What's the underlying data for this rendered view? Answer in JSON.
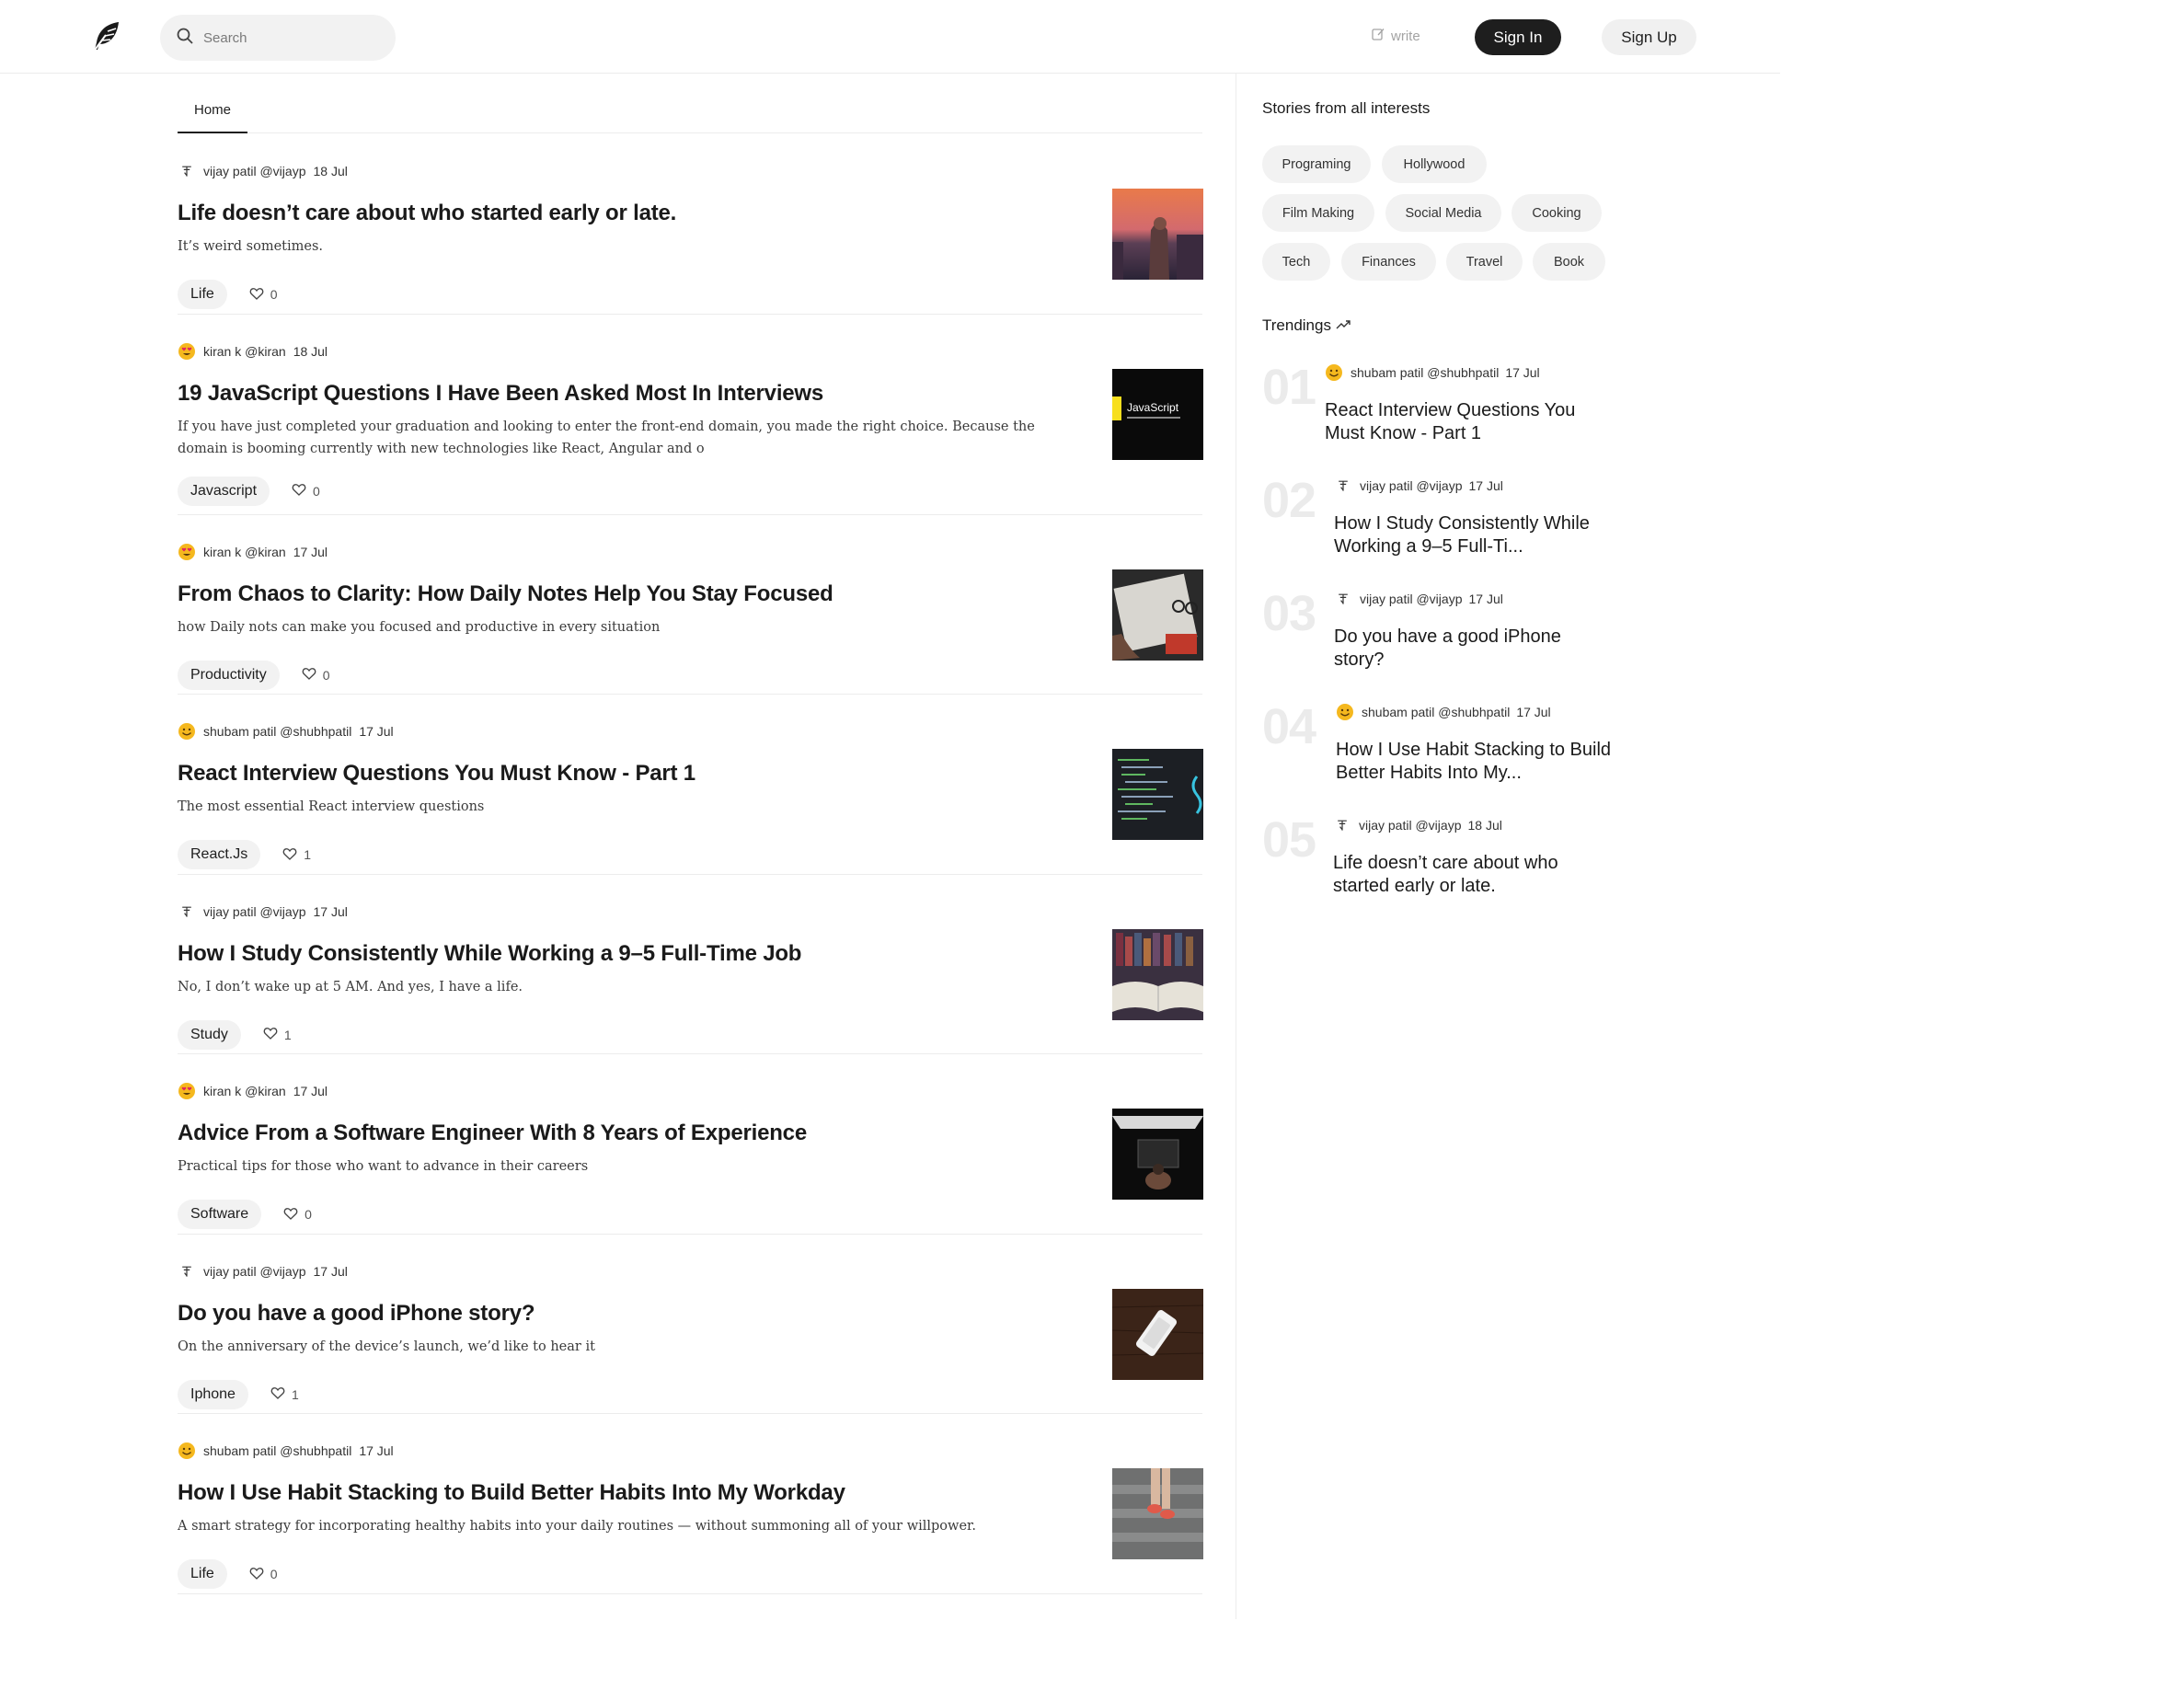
{
  "header": {
    "search_placeholder": "Search",
    "write_label": "write",
    "signin_label": "Sign In",
    "signup_label": "Sign Up"
  },
  "tabs": {
    "home": "Home"
  },
  "posts": [
    {
      "avatar": "pen-avatar",
      "author": "vijay patil @vijayp",
      "date": "18 Jul",
      "title": "Life doesn’t care about who started early or late.",
      "description": "It’s weird sometimes.",
      "tag": "Life",
      "likes": "0",
      "thumb": "sunset-city"
    },
    {
      "avatar": "heart-eyes-emoji",
      "author": "kiran k @kiran",
      "date": "18 Jul",
      "title": "19 JavaScript Questions I Have Been Asked Most In Interviews",
      "description": "If you have just completed your graduation and looking to enter the front-end domain, you made the right choice. Because the domain is booming currently with new technologies like React, Angular and o",
      "tag": "Javascript",
      "likes": "0",
      "thumb": "javascript",
      "thumb_text": "JavaScript"
    },
    {
      "avatar": "heart-eyes-emoji",
      "author": "kiran k @kiran",
      "date": "17 Jul",
      "title": "From Chaos to Clarity: How Daily Notes Help You Stay Focused",
      "description": "how Daily nots can make you focused and productive in every situation",
      "tag": "Productivity",
      "likes": "0",
      "thumb": "notebook"
    },
    {
      "avatar": "smile-emoji",
      "author": "shubam patil @shubhpatil",
      "date": "17 Jul",
      "title": "React Interview Questions You Must Know - Part 1",
      "description": "The most essential React interview questions",
      "tag": "React.Js",
      "likes": "1",
      "thumb": "code"
    },
    {
      "avatar": "pen-avatar",
      "author": "vijay patil @vijayp",
      "date": "17 Jul",
      "title": "How I Study Consistently While Working a 9–5 Full-Time Job",
      "description": "No, I don’t wake up at 5 AM. And yes, I have a life.",
      "tag": "Study",
      "likes": "1",
      "thumb": "books"
    },
    {
      "avatar": "heart-eyes-emoji",
      "author": "kiran k @kiran",
      "date": "17 Jul",
      "title": "Advice From a Software Engineer With 8 Years of Experience",
      "description": "Practical tips for those who want to advance in their careers",
      "tag": "Software",
      "likes": "0",
      "thumb": "desk"
    },
    {
      "avatar": "pen-avatar",
      "author": "vijay patil @vijayp",
      "date": "17 Jul",
      "title": "Do you have a good iPhone story?",
      "description": "On the anniversary of the device’s launch, we’d like to hear it",
      "tag": "Iphone",
      "likes": "1",
      "thumb": "iphone"
    },
    {
      "avatar": "smile-emoji",
      "author": "shubam patil @shubhpatil",
      "date": "17 Jul",
      "title": "How I Use Habit Stacking to Build Better Habits Into My Workday",
      "description": "A smart strategy for incorporating healthy habits into your daily routines — without summoning all of your willpower.",
      "tag": "Life",
      "likes": "0",
      "thumb": "stairs"
    }
  ],
  "sidebar": {
    "stories_title": "Stories from all interests",
    "interests": [
      "Programing",
      "Hollywood",
      "Film Making",
      "Social Media",
      "Cooking",
      "Tech",
      "Finances",
      "Travel",
      "Book"
    ],
    "trending_title": "Trendings",
    "trending": [
      {
        "num": "01",
        "avatar": "smile-emoji",
        "author": "shubam patil @shubhpatil",
        "date": "17 Jul",
        "title": "React Interview Questions You Must Know - Part 1"
      },
      {
        "num": "02",
        "avatar": "pen-avatar",
        "author": "vijay patil @vijayp",
        "date": "17 Jul",
        "title": "How I Study Consistently While Working a 9–5 Full-Ti..."
      },
      {
        "num": "03",
        "avatar": "pen-avatar",
        "author": "vijay patil @vijayp",
        "date": "17 Jul",
        "title": "Do you have a good iPhone story?"
      },
      {
        "num": "04",
        "avatar": "smile-emoji",
        "author": "shubam patil @shubhpatil",
        "date": "17 Jul",
        "title": "How I Use Habit Stacking to Build Better Habits Into My..."
      },
      {
        "num": "05",
        "avatar": "pen-avatar",
        "author": "vijay patil @vijayp",
        "date": "18 Jul",
        "title": "Life doesn’t care about who started early or late."
      }
    ]
  },
  "colors": {
    "primary_button": "#1e1e1e",
    "chip_bg": "#f2f2f2",
    "divider": "#ececec",
    "trend_number": "#ebebeb"
  }
}
